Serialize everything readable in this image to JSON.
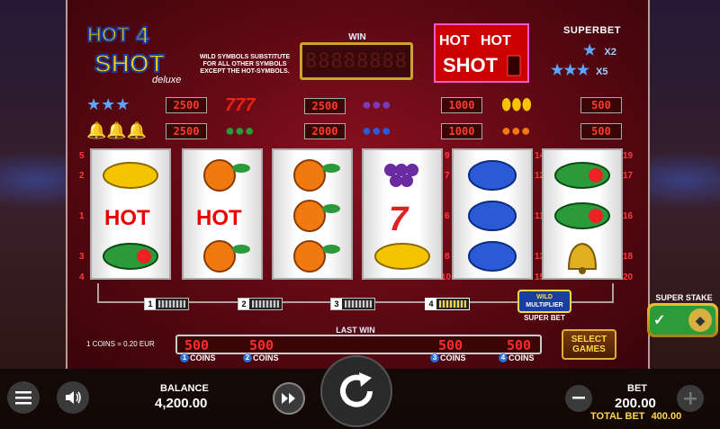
{
  "game": {
    "logo_line1": "HOT",
    "logo_num": "4",
    "logo_line2": "SHOT",
    "logo_deluxe": "deluxe",
    "wild_info": "WILD SYMBOLS SUBSTITUTE FOR ALL OTHER SYMBOLS EXCEPT THE HOT-SYMBOLS.",
    "win_label": "WIN",
    "win_display": "88888888",
    "hotshot_text1": "HOT",
    "hotshot_text2": "SHOT"
  },
  "superbet": {
    "label": "SUPERBET",
    "rows": [
      {
        "symbol": "WILD",
        "multiplier": "X2"
      },
      {
        "symbol": "WILD WILD",
        "multiplier": "X5"
      }
    ]
  },
  "paytable": [
    {
      "symbols": "WILD WILD WILD",
      "value": "2500"
    },
    {
      "symbols": "777",
      "value": "2500"
    },
    {
      "symbols": "grapes",
      "value": "1000"
    },
    {
      "symbols": "lemons",
      "value": "500"
    },
    {
      "symbols": "bells",
      "value": "2500"
    },
    {
      "symbols": "melons",
      "value": "2000"
    },
    {
      "symbols": "plums",
      "value": "1000"
    },
    {
      "symbols": "oranges",
      "value": "500"
    }
  ],
  "line_numbers": {
    "left": [
      "5",
      "2",
      "1",
      "3",
      "4"
    ],
    "mid_left": [
      "9",
      "7",
      "6",
      "8",
      "10"
    ],
    "mid_right": [
      "14",
      "12",
      "11",
      "13",
      "15"
    ],
    "right": [
      "19",
      "17",
      "16",
      "18",
      "20"
    ]
  },
  "coin_markers": [
    "1",
    "2",
    "3",
    "4"
  ],
  "wild_multiplier": {
    "top": "WILD",
    "middle": "MULTIPLIER",
    "bottom": "SUPER BET"
  },
  "coins_eq": "1 COINS = 0.20 EUR",
  "last_win": {
    "label": "LAST WIN",
    "values": [
      "500",
      "500",
      "500",
      "500"
    ],
    "tags": [
      "COINS",
      "COINS",
      "COINS",
      "COINS"
    ],
    "tag_nums": [
      "1",
      "2",
      "3",
      "4"
    ]
  },
  "select_games": "SELECT GAMES",
  "super_stake": {
    "label": "SUPER STAKE"
  },
  "bottom": {
    "balance_label": "BALANCE",
    "balance_value": "4,200.00",
    "bet_label": "BET",
    "bet_value": "200.00",
    "total_bet_label": "TOTAL BET",
    "total_bet_value": "400.00"
  },
  "reels": [
    [
      "lemon",
      "hot",
      "melon"
    ],
    [
      "orange",
      "hot",
      "orange"
    ],
    [
      "orange",
      "orange",
      "orange"
    ],
    [
      "grapes",
      "seven",
      "lemon"
    ],
    [
      "plum",
      "plum",
      "plum"
    ],
    [
      "melon",
      "melon",
      "bell"
    ]
  ],
  "colors": {
    "cabinet": "#5a0812",
    "accent_red": "#ff2b2b",
    "gold": "#ffd84a",
    "toggle_green": "#2e9b3a"
  }
}
